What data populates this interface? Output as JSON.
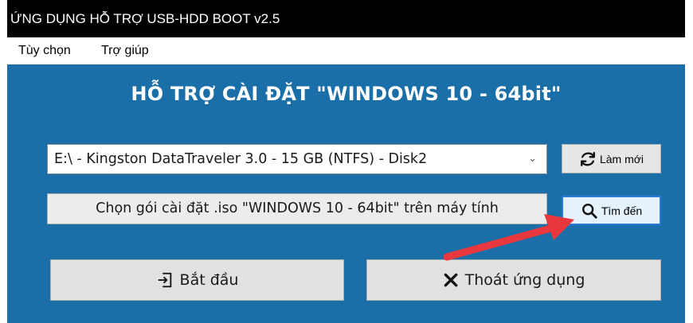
{
  "window": {
    "title": "ỨNG DỤNG HỖ TRỢ USB-HDD BOOT v2.5"
  },
  "menu": {
    "items": [
      {
        "label": "Tùy chọn"
      },
      {
        "label": "Trợ giúp"
      }
    ]
  },
  "main": {
    "heading": "HỖ TRỢ CÀI ĐẶT \"WINDOWS 10 - 64bit\"",
    "drive_select": {
      "value": "E:\\ - Kingston DataTraveler 3.0 - 15 GB (NTFS) - Disk2"
    },
    "iso_field": {
      "value": "Chọn gói cài đặt .iso \"WINDOWS 10 - 64bit\" trên máy tính"
    },
    "refresh_button": {
      "label": "Làm mới",
      "icon": "refresh-icon"
    },
    "find_button": {
      "label": "Tìm đến",
      "icon": "search-icon"
    },
    "start_button": {
      "label": "Bắt đầu",
      "icon": "enter-icon"
    },
    "quit_button": {
      "label": "Thoát ứng dụng",
      "icon": "close-icon"
    }
  },
  "colors": {
    "background": "#1a6fa9",
    "titlebar": "#000000",
    "annotation_arrow": "#e8383d",
    "focus_border": "#2c7bd4"
  }
}
